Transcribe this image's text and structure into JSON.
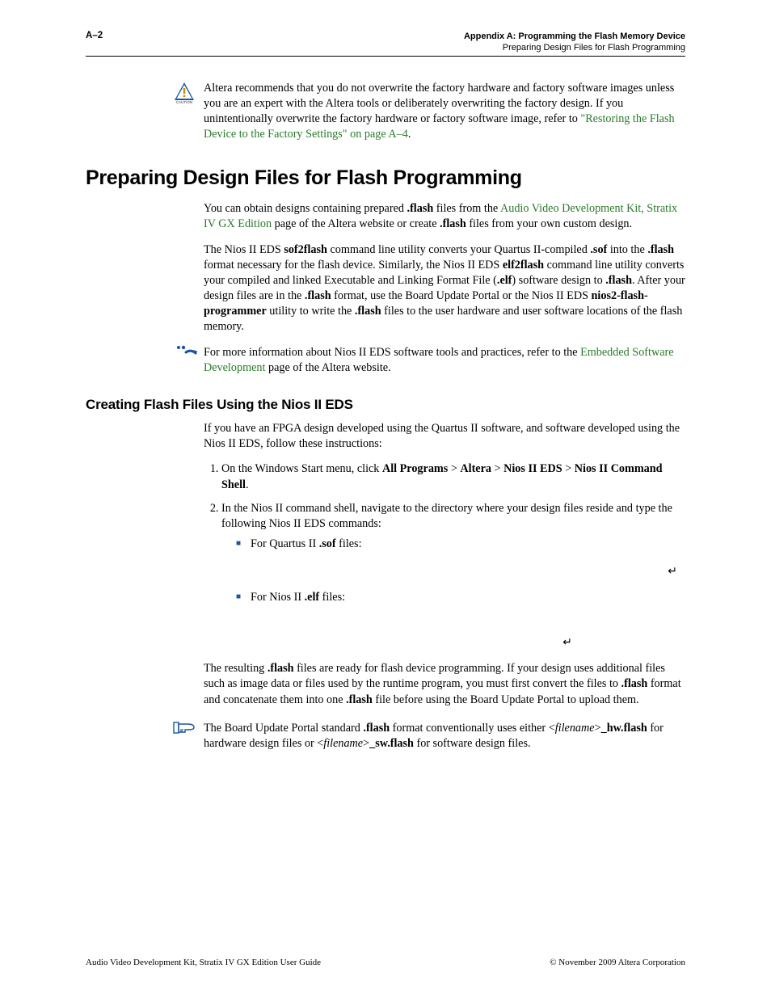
{
  "header": {
    "page_number": "A–2",
    "title_line1": "Appendix A:  Programming the Flash Memory Device",
    "title_line2": "Preparing Design Files for Flash Programming"
  },
  "caution": {
    "text_pre": "Altera recommends that you do not overwrite the factory hardware and factory software images unless you are an expert with the Altera tools or deliberately overwriting the factory design. If you unintentionally overwrite the factory hardware or factory software image, refer to ",
    "link": "\"Restoring the Flash Device to the Factory Settings\" on page A–4",
    "text_post": "."
  },
  "section": {
    "heading": "Preparing Design Files for Flash Programming",
    "p1_pre": "You can obtain designs containing prepared ",
    "p1_b1": ".flash",
    "p1_mid": " files from the ",
    "p1_link": "Audio Video Development Kit, Stratix IV GX Edition",
    "p1_mid2": " page of the Altera website or create ",
    "p1_b2": ".flash",
    "p1_post": " files from your own custom design.",
    "p2_a": "The Nios II EDS ",
    "p2_b1": "sof2flash",
    "p2_b": " command line utility converts your Quartus II-compiled ",
    "p2_b2": ".sof",
    "p2_c": " into the ",
    "p2_b3": ".flash",
    "p2_d": " format necessary for the flash device. Similarly, the Nios II EDS ",
    "p2_b4": "elf2flash",
    "p2_e": " command line utility converts your compiled and linked Executable and Linking Format File (",
    "p2_b5": ".elf",
    "p2_f": ") software design to ",
    "p2_b6": ".flash",
    "p2_g": ". After your design files are in the ",
    "p2_b7": ".flash",
    "p2_h": " format, use the Board Update Portal or the Nios II EDS ",
    "p2_b8": "nios2-flash-programmer",
    "p2_i": " utility to write the ",
    "p2_b9": ".flash",
    "p2_j": " files to the user hardware and user software locations of the flash memory.",
    "p3_a": "For more information about Nios II EDS software tools and practices, refer to the ",
    "p3_link": "Embedded Software Development",
    "p3_b": " page of the Altera website."
  },
  "subsection": {
    "heading": "Creating Flash Files Using the Nios II EDS",
    "intro": "If you have an FPGA design developed using the Quartus II software, and software developed using the Nios II EDS, follow these instructions:",
    "step1_a": "On the Windows Start menu, click ",
    "step1_b1": "All Programs",
    "step1_gt1": " > ",
    "step1_b2": "Altera",
    "step1_gt2": " > ",
    "step1_b3": "Nios II EDS",
    "step1_gt3": " > ",
    "step1_b4": "Nios II Command Shell",
    "step1_end": ".",
    "step2": "In the Nios II command shell, navigate to the directory where your design files reside and type the following Nios II EDS commands:",
    "bullet1_a": "For Quartus II ",
    "bullet1_b": ".sof",
    "bullet1_c": " files:",
    "bullet2_a": "For Nios II ",
    "bullet2_b": ".elf",
    "bullet2_c": " files:",
    "ret": "↵",
    "result_a": "The resulting ",
    "result_b1": ".flash",
    "result_b": " files are ready for flash device programming. If your design uses additional files such as image data or files used by the runtime program, you must first convert the files to ",
    "result_b2": ".flash",
    "result_c": " format and concatenate them into one ",
    "result_b3": ".flash",
    "result_d": " file before using the Board Update Portal to upload them.",
    "note_a": "The Board Update Portal standard ",
    "note_b1": ".flash",
    "note_b": " format conventionally uses either <",
    "note_i1": "filename",
    "note_c": ">",
    "note_b2": "_hw.flash",
    "note_d": " for hardware design files or <",
    "note_i2": "filename",
    "note_e": ">",
    "note_b3": "_sw.flash",
    "note_f": " for software design files."
  },
  "footer": {
    "left": "Audio Video Development Kit, Stratix IV GX Edition User Guide",
    "right": "© November 2009   Altera Corporation"
  }
}
